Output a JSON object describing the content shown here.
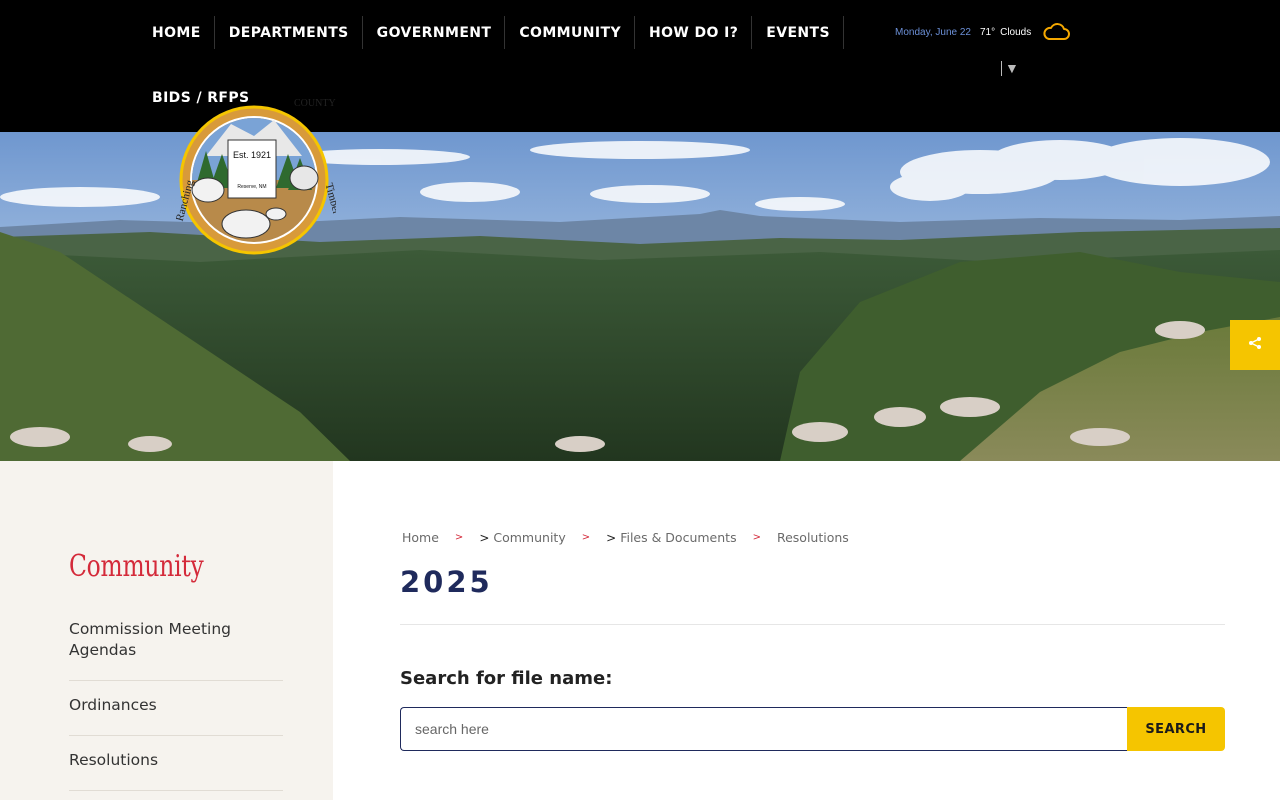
{
  "nav": {
    "items": [
      {
        "label": "HOME"
      },
      {
        "label": "DEPARTMENTS"
      },
      {
        "label": "GOVERNMENT"
      },
      {
        "label": "COMMUNITY"
      },
      {
        "label": "HOW DO I?"
      },
      {
        "label": "EVENTS"
      },
      {
        "label": "BIDS / RFPS"
      }
    ]
  },
  "weather": {
    "date": "Monday, June 22",
    "temperature": "71°",
    "condition": "Clouds",
    "icon": "cloud-icon"
  },
  "language_selector": {
    "arrow": "▼"
  },
  "seal": {
    "top_text": "COUNTY",
    "established": "Est. 1921",
    "left_text": "Ranching",
    "right_text": "Timber",
    "location": "Reserve, NM"
  },
  "share_tab": {
    "icon": "share-icon"
  },
  "sidebar": {
    "title": "Community",
    "items": [
      {
        "label": "Commission Meeting Agendas"
      },
      {
        "label": "Ordinances"
      },
      {
        "label": "Resolutions"
      }
    ]
  },
  "breadcrumb": {
    "items": [
      "Home",
      "Community",
      "Files & Documents",
      "Resolutions"
    ],
    "separator": ">",
    "prefix": ">"
  },
  "main": {
    "title": "2025",
    "search_label": "Search for file name:",
    "search_placeholder": "search here",
    "search_button": "SEARCH"
  },
  "colors": {
    "header_bg": "#000000",
    "accent_yellow": "#f5c500",
    "title_red": "#d42a3a",
    "navy": "#1f2a5c",
    "sidebar_bg": "#f6f3ee"
  }
}
